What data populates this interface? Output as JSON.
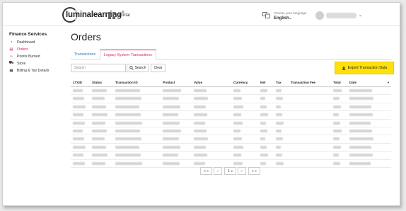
{
  "header": {
    "logo_text": "luminalearning",
    "logo_mark": "®",
    "portal_label": "Portal",
    "language_label": "Choose your language",
    "language_value": "English",
    "icons": [
      "apps-grid-icon",
      "language-icon",
      "chevron-down-icon"
    ]
  },
  "sidebar": {
    "title": "Finance Services",
    "items": [
      {
        "label": "Dashboard",
        "icon": "dashboard-icon",
        "glyph": "◔"
      },
      {
        "label": "Orders",
        "icon": "orders-icon",
        "glyph": "▤",
        "active": true
      },
      {
        "label": "Points Burned",
        "icon": "fire-icon",
        "glyph": "♨"
      },
      {
        "label": "Store",
        "icon": "cart-icon",
        "glyph": "⛟"
      },
      {
        "label": "Billing & Tax Details",
        "icon": "billing-icon",
        "glyph": "▦"
      }
    ]
  },
  "main": {
    "title": "Orders",
    "tabs": [
      {
        "label": "Transactions"
      },
      {
        "label": "Legacy System Transactions",
        "active": true
      }
    ],
    "search": {
      "placeholder": "Search",
      "button_label": "Search",
      "clear_label": "Clear"
    },
    "export_label": "Export Transaction Data"
  },
  "table": {
    "columns": [
      "LTXID",
      "Status",
      "Transaction ID",
      "Product",
      "Value",
      "Currency",
      "Net",
      "Tax",
      "Transaction Fee",
      "Total",
      "Date"
    ],
    "row_count": 10
  },
  "pagination": {
    "first": "« «",
    "prev": "‹",
    "page": "1",
    "next": "›",
    "last": "» »"
  },
  "colors": {
    "accent": "#d62a5e",
    "link": "#2a7ab8",
    "export": "#ffe00a"
  }
}
